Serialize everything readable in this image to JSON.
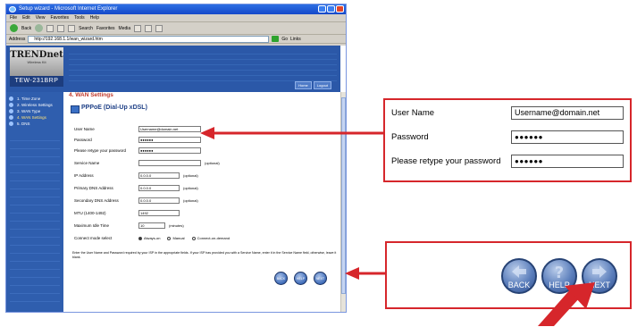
{
  "browser": {
    "window_title": "Setup wizard - Microsoft Internet Explorer",
    "menu": [
      "File",
      "Edit",
      "View",
      "Favorites",
      "Tools",
      "Help"
    ],
    "toolbar": {
      "back_label": "Back",
      "search_label": "Search",
      "favorites_label": "Favorites",
      "media_label": "Media"
    },
    "address_label": "Address",
    "address_value": "http://192.168.1.1/wan_wizard.htm",
    "go_label": "Go",
    "links_label": "Links"
  },
  "router_page": {
    "brand": "TRENDnet",
    "brand_tagline": "Wireless Kit",
    "model": "TEW-231BRP",
    "banner_buttons": [
      "Home",
      "Logout"
    ],
    "wizard_steps": [
      {
        "label": "1. Time Zone",
        "active": false
      },
      {
        "label": "2. Wireless Settings",
        "active": false
      },
      {
        "label": "3. WAN Type",
        "active": false
      },
      {
        "label": "4. WAN Settings",
        "active": true
      },
      {
        "label": "5. DNS",
        "active": false
      }
    ],
    "section_title": "4. WAN Settings",
    "pppoe_title": "PPPoE (Dial-Up xDSL)",
    "fields": {
      "user_name": {
        "label": "User Name",
        "value": "Username@domain.net"
      },
      "password": {
        "label": "Password",
        "value": "●●●●●●"
      },
      "retype_password": {
        "label": "Please retype your password",
        "value": "●●●●●●"
      },
      "service_name": {
        "label": "Service Name",
        "value": "",
        "note": "(optional)"
      },
      "ip_address": {
        "label": "IP Address",
        "value": "0.0.0.0",
        "note": "(optional)"
      },
      "primary_dns": {
        "label": "Primary DNS Address",
        "value": "0.0.0.0",
        "note": "(optional)"
      },
      "secondary_dns": {
        "label": "Secondary DNS Address",
        "value": "0.0.0.0",
        "note": "(optional)"
      },
      "mtu": {
        "label": "MTU (1400-1492)",
        "value": "1492"
      },
      "idle_time": {
        "label": "Maximum Idle Time",
        "value": "10",
        "note": "(minutes)"
      },
      "connect_mode": {
        "label": "Connect mode select",
        "options": [
          "Always-on",
          "Manual",
          "Connect-on-demand"
        ],
        "selected": "Always-on"
      }
    },
    "help_text": "Enter the User Name and Password required by your ISP in the appropriate fields. If your ISP has provided you with a Service Name, enter it in the Service Name field, otherwise, leave it blank.",
    "nav_buttons": {
      "back": "BACK",
      "help": "HELP",
      "next": "NEXT"
    }
  },
  "callout_fields": {
    "user_name": {
      "label": "User Name",
      "value": "Username@domain.net"
    },
    "password": {
      "label": "Password",
      "value": "●●●●●●"
    },
    "retype_password": {
      "label": "Please retype your password",
      "value": "●●●●●●"
    }
  },
  "callout_buttons": {
    "back": "BACK",
    "help": "HELP",
    "next": "NEXT"
  },
  "colors": {
    "accent_red": "#d6262b",
    "page_blue": "#2b58a8",
    "ie_blue": "#1448c9"
  }
}
